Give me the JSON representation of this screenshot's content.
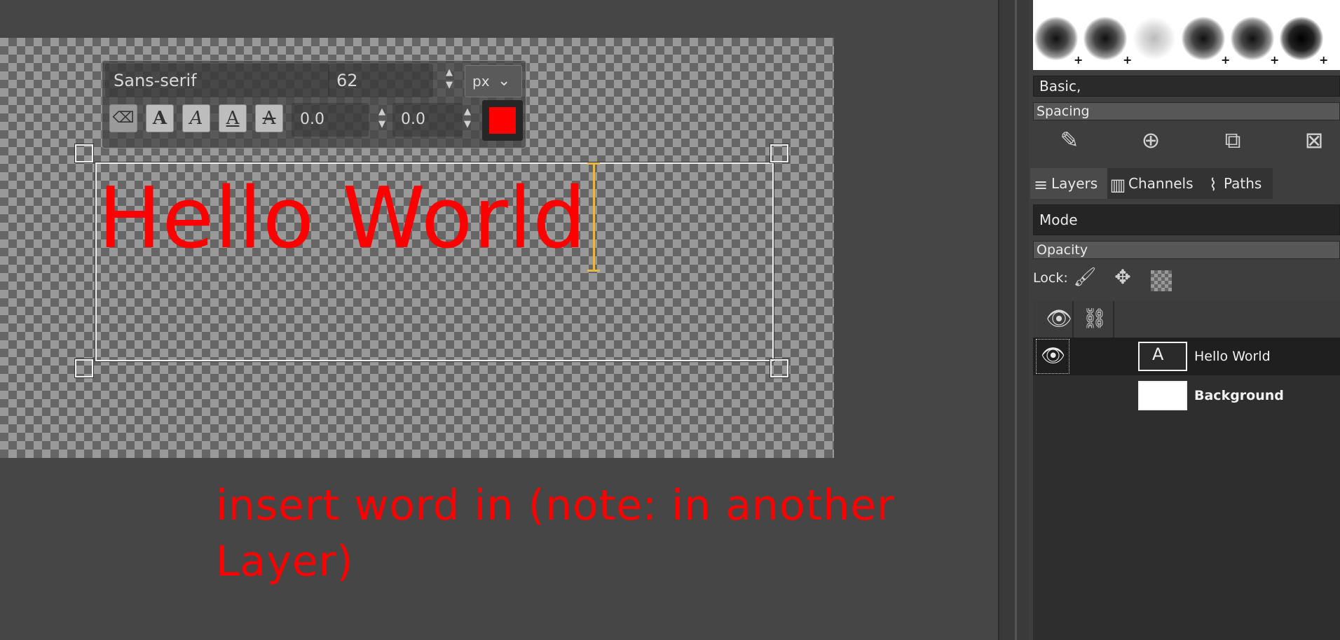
{
  "text_toolbox": {
    "font": "Sans-serif",
    "size": "62",
    "unit": "px",
    "unit_dropdown_icon": "chevron-down-icon",
    "style_buttons": [
      {
        "name": "clear-style-button",
        "glyph": "⌫"
      },
      {
        "name": "bold-button",
        "glyph": "A"
      },
      {
        "name": "italic-button",
        "glyph": "A"
      },
      {
        "name": "underline-button",
        "glyph": "A"
      },
      {
        "name": "strikethrough-button",
        "glyph": "A"
      }
    ],
    "baseline": "0.0",
    "kerning": "0.0",
    "text_color": "#ff0000"
  },
  "canvas": {
    "text": "Hello World",
    "annotation": "insert word in (note: in another Layer)"
  },
  "dock": {
    "brush_preset": "Basic,",
    "spacing_label": "Spacing",
    "brush_actions": [
      "edit-brush-icon",
      "new-brush-icon",
      "duplicate-brush-icon",
      "delete-brush-icon"
    ],
    "tabs": [
      {
        "label": "Layers",
        "icon": "layers-icon"
      },
      {
        "label": "Channels",
        "icon": "channels-icon"
      },
      {
        "label": "Paths",
        "icon": "paths-icon"
      }
    ],
    "mode_label": "Mode",
    "opacity_label": "Opacity",
    "lock_label": "Lock:",
    "layers": [
      {
        "name": "Hello World",
        "type": "text"
      },
      {
        "name": "Background",
        "type": "image"
      }
    ]
  },
  "colors": {
    "accent_red": "#ff0000",
    "canvas_bg": "#464646",
    "cursor": "#e6b84a"
  }
}
